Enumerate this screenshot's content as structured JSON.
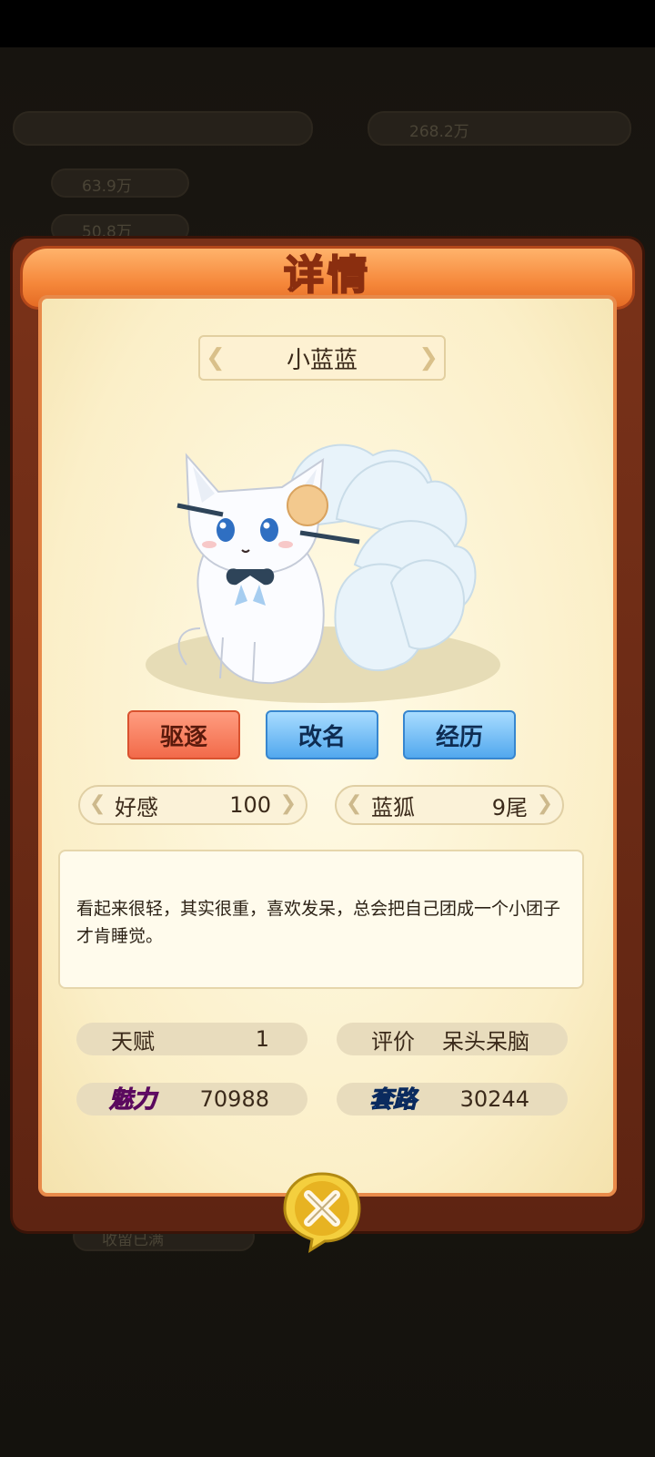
{
  "background": {
    "texts": [
      "268.2万",
      "63.9万",
      "50.8万",
      "收留已满"
    ]
  },
  "panel": {
    "title": "详情",
    "name": "小蓝蓝",
    "actions": {
      "expel_label": "驱逐",
      "rename_label": "改名",
      "history_label": "经历"
    },
    "affection": {
      "label": "好感",
      "value": "100"
    },
    "species": {
      "label": "蓝狐",
      "value": "9尾"
    },
    "description": "看起来很轻，其实很重，喜欢发呆，总会把自己团成一个小团子才肯睡觉。",
    "talent": {
      "label": "天赋",
      "value": "1"
    },
    "rating": {
      "label": "评价",
      "value": "呆头呆脑"
    },
    "charm": {
      "label": "魅力",
      "value": "70988"
    },
    "routine": {
      "label": "套路",
      "value": "30244"
    }
  },
  "colors": {
    "expel": "#f26a4a",
    "rename": "#52a8ee",
    "history": "#52a8ee",
    "charm_badge": "#d12ad6",
    "routine_badge": "#1e6fe0"
  },
  "icons": {
    "close": "close-x-icon"
  }
}
